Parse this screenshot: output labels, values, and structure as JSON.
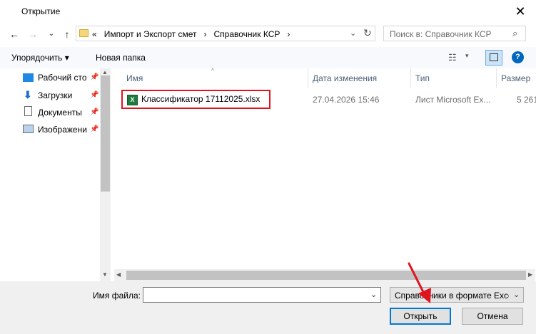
{
  "window": {
    "title": "Открытие"
  },
  "address": {
    "prefix": "«",
    "path": [
      "Импорт и Экспорт смет",
      "Справочник КСР"
    ],
    "separator": "›"
  },
  "search": {
    "placeholder": "Поиск в: Справочник КСР"
  },
  "toolbar": {
    "organize": "Упорядочить ▾",
    "new_folder": "Новая папка"
  },
  "nav": {
    "items": [
      {
        "label": "Рабочий сто",
        "icon": "desktop-icon"
      },
      {
        "label": "Загрузки",
        "icon": "download-icon"
      },
      {
        "label": "Документы",
        "icon": "documents-icon"
      },
      {
        "label": "Изображени",
        "icon": "pictures-icon"
      }
    ]
  },
  "columns": {
    "name": "Имя",
    "date": "Дата изменения",
    "type": "Тип",
    "size": "Размер"
  },
  "files": [
    {
      "name": "Классификатор 17112025.xlsx",
      "date": "27.04.2026 15:46",
      "type": "Лист Microsoft Ex...",
      "size": "5 261"
    }
  ],
  "bottom": {
    "filename_label": "Имя файла:",
    "filename_value": "",
    "filetype": "Справочники в формате Exce",
    "open": "Открыть",
    "cancel": "Отмена"
  },
  "colors": {
    "highlight": "#e0141e",
    "accent": "#0078d7"
  }
}
